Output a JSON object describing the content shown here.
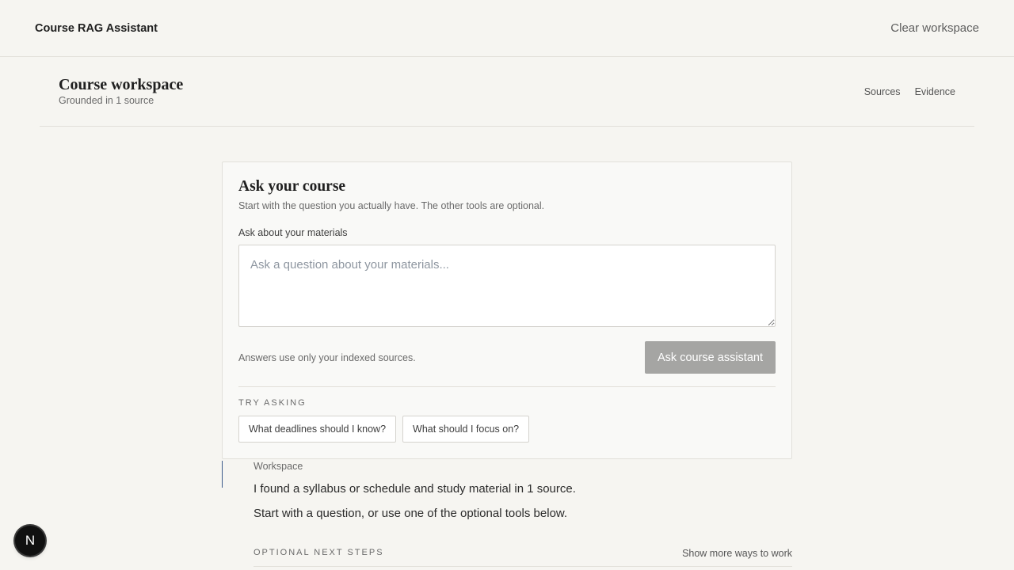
{
  "app": {
    "title": "Course RAG Assistant",
    "clear_label": "Clear workspace"
  },
  "workspace": {
    "title": "Course workspace",
    "subtitle": "Grounded in 1 source",
    "links": [
      "Sources",
      "Evidence"
    ]
  },
  "ask": {
    "title": "Ask your course",
    "subtitle": "Start with the question you actually have. The other tools are optional.",
    "field_label": "Ask about your materials",
    "placeholder": "Ask a question about your materials...",
    "value": "",
    "note": "Answers use only your indexed sources.",
    "button_label": "Ask course assistant",
    "try_label": "TRY ASKING",
    "suggestions": [
      "What deadlines should I know?",
      "What should I focus on?"
    ]
  },
  "message": {
    "label": "Workspace",
    "line1": "I found a syllabus or schedule and study material in 1 source.",
    "line2": "Start with a question, or use one of the optional tools below."
  },
  "next_steps": {
    "label": "OPTIONAL NEXT STEPS",
    "more_label": "Show more ways to work"
  },
  "badge": {
    "letter": "N",
    "icon": "nextjs-logo-icon"
  },
  "colors": {
    "background": "#f6f5f1",
    "card": "#f9f9f7",
    "button_disabled": "#a5a5a3",
    "accent_rule": "#3c5a8a"
  }
}
